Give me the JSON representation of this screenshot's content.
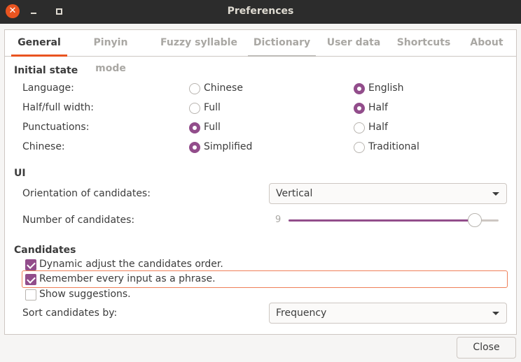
{
  "window": {
    "title": "Preferences"
  },
  "tabs": [
    {
      "label": "General"
    },
    {
      "label": "Pinyin mode"
    },
    {
      "label": "Fuzzy syllable"
    },
    {
      "label": "Dictionary"
    },
    {
      "label": "User data"
    },
    {
      "label": "Shortcuts"
    },
    {
      "label": "About"
    }
  ],
  "initial_state": {
    "heading": "Initial state",
    "rows": [
      {
        "label": "Language:",
        "opt1": "Chinese",
        "opt2": "English",
        "selected": "English"
      },
      {
        "label": "Half/full width:",
        "opt1": "Full",
        "opt2": "Half",
        "selected": "Half"
      },
      {
        "label": "Punctuations:",
        "opt1": "Full",
        "opt2": "Half",
        "selected": "Full"
      },
      {
        "label": "Chinese:",
        "opt1": "Simplified",
        "opt2": "Traditional",
        "selected": "Simplified"
      }
    ]
  },
  "ui": {
    "heading": "UI",
    "orientation_label": "Orientation of candidates:",
    "orientation_value": "Vertical",
    "number_label": "Number of candidates:",
    "number_value": "9",
    "number_fraction": 0.89
  },
  "candidates": {
    "heading": "Candidates",
    "options": [
      {
        "label": "Dynamic adjust the candidates order.",
        "checked": true
      },
      {
        "label": "Remember every input as a phrase.",
        "checked": true
      },
      {
        "label": "Show suggestions.",
        "checked": false
      }
    ],
    "sort_label": "Sort candidates by:",
    "sort_value": "Frequency"
  },
  "footer": {
    "close_label": "Close"
  },
  "colors": {
    "accent": "#e95420",
    "selection": "#924d8b",
    "titlebar": "#2c2c2c"
  }
}
